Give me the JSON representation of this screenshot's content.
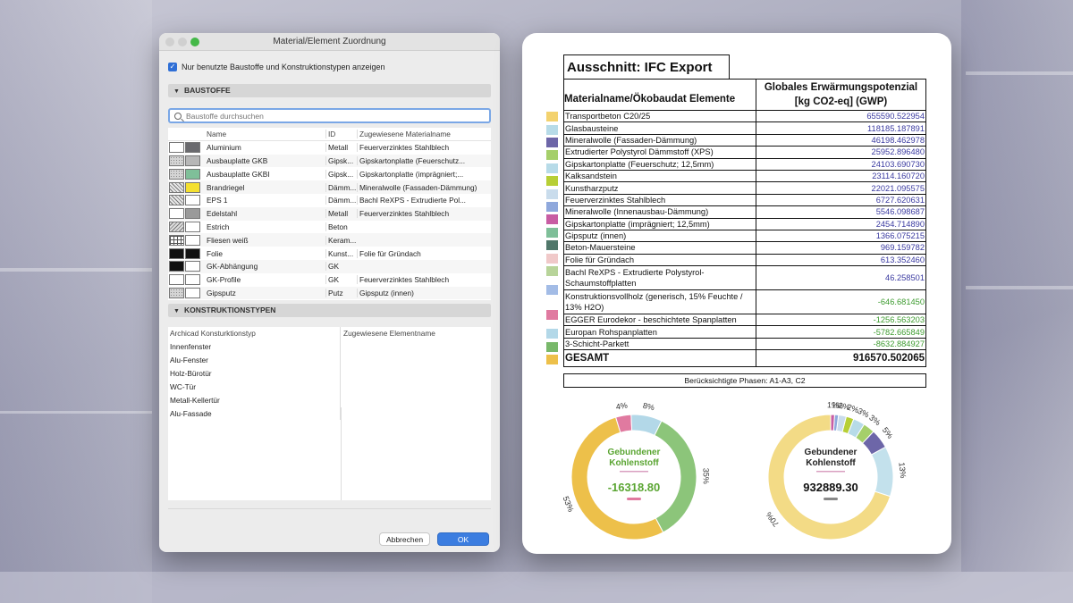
{
  "dialog": {
    "title": "Material/Element Zuordnung",
    "checkbox_label": "Nur benutzte Baustoffe und Konstruktionstypen anzeigen",
    "section_materials": "BAUSTOFFE",
    "search_placeholder": "Baustoffe durchsuchen",
    "materials_columns": {
      "name": "Name",
      "id": "ID",
      "assigned": "Zugewiesene Materialname"
    },
    "materials": [
      {
        "name": "Aluminium",
        "id": "Metall",
        "assigned": "Feuerverzinktes Stahlblech",
        "sw1": "#ffffff",
        "sw2": "#6a6a6e",
        "p1": "plain",
        "p2": "plain"
      },
      {
        "name": "Ausbauplatte GKB",
        "id": "Gipsk...",
        "assigned": "Gipskartonplatte (Feuerschutz...",
        "sw1": "#d4d4d4",
        "sw2": "#b7b7b7",
        "p1": "dots",
        "p2": "plain"
      },
      {
        "name": "Ausbauplatte GKBI",
        "id": "Gipsk...",
        "assigned": "Gipskartonplatte (imprägniert;...",
        "sw1": "#d4d4d4",
        "sw2": "#7fbf99",
        "p1": "dots",
        "p2": "plain"
      },
      {
        "name": "Brandriegel",
        "id": "Dämm...",
        "assigned": "Mineralwolle (Fassaden-Dämmung)",
        "sw1": "#e8e8e8",
        "sw2": "#f4e030",
        "p1": "wave",
        "p2": "plain"
      },
      {
        "name": "EPS 1",
        "id": "Dämm...",
        "assigned": "Bachl ReXPS - Extrudierte Pol...",
        "sw1": "#e8e8e8",
        "sw2": "#ffffff",
        "p1": "wave",
        "p2": "plain"
      },
      {
        "name": "Edelstahl",
        "id": "Metall",
        "assigned": "Feuerverzinktes Stahlblech",
        "sw1": "#ffffff",
        "sw2": "#9a9a9a",
        "p1": "plain",
        "p2": "plain"
      },
      {
        "name": "Estrich",
        "id": "Beton",
        "assigned": "",
        "sw1": "#dcdcdc",
        "sw2": "#ffffff",
        "p1": "hatch",
        "p2": "plain"
      },
      {
        "name": "Fliesen weiß",
        "id": "Keram...",
        "assigned": "",
        "sw1": "#ffffff",
        "sw2": "#ffffff",
        "p1": "grid",
        "p2": "plain"
      },
      {
        "name": "Folie",
        "id": "Kunst...",
        "assigned": "Folie für Gründach",
        "sw1": "#111111",
        "sw2": "#111111",
        "p1": "plain",
        "p2": "plain"
      },
      {
        "name": "GK-Abhängung",
        "id": "GK",
        "assigned": "",
        "sw1": "#111111",
        "sw2": "#ffffff",
        "p1": "plain",
        "p2": "plain"
      },
      {
        "name": "GK-Profile",
        "id": "GK",
        "assigned": "Feuerverzinktes Stahlblech",
        "sw1": "#ffffff",
        "sw2": "#ffffff",
        "p1": "plain",
        "p2": "plain"
      },
      {
        "name": "Gipsputz",
        "id": "Putz",
        "assigned": "Gipsputz (innen)",
        "sw1": "#d4d4d4",
        "sw2": "#ffffff",
        "p1": "dots",
        "p2": "plain"
      }
    ],
    "section_types": "KONSTRUKTIONSTYPEN",
    "types_columns": {
      "type": "Archicad Konsturktionstyp",
      "element": "Zugewiesene Elementname"
    },
    "types": [
      "Innenfenster",
      "Alu-Fenster",
      "Holz-Bürotür",
      "WC-Tür",
      "Metall-Kellertür",
      "Alu-Fassade"
    ],
    "cancel_label": "Abbrechen",
    "ok_label": "OK"
  },
  "report": {
    "title": "Ausschnitt: IFC Export",
    "col_name": "Materialname/Ökobaudat Elemente",
    "col_value_line1": "Globales Erwärmungspotenzial",
    "col_value_line2": "[kg CO2-eq] (GWP)",
    "rows": [
      {
        "name": "Transportbeton C20/25",
        "value": "655590.522954",
        "color": "#f3d26e",
        "val_color": "#3a3aa0",
        "lines": 1
      },
      {
        "name": "Glasbausteine",
        "value": "118185.187891",
        "color": "#b7dbe8",
        "val_color": "#3a3aa0",
        "lines": 1
      },
      {
        "name": "Mineralwolle (Fassaden-Dämmung)",
        "value": "46198.462978",
        "color": "#6d66a8",
        "val_color": "#3a3aa0",
        "lines": 1
      },
      {
        "name": "Extrudierter Polystyrol Dämmstoff (XPS)",
        "value": "25952.896480",
        "color": "#a5cf6a",
        "val_color": "#3a3aa0",
        "lines": 1
      },
      {
        "name": "Gipskartonplatte (Feuerschutz; 12,5mm)",
        "value": "24103.690730",
        "color": "#b7dbe8",
        "val_color": "#3a3aa0",
        "lines": 1
      },
      {
        "name": "Kalksandstein",
        "value": "23114.160720",
        "color": "#b7cf36",
        "val_color": "#3a3aa0",
        "lines": 1
      },
      {
        "name": "Kunstharzputz",
        "value": "22021.095575",
        "color": "#c9dcec",
        "val_color": "#3a3aa0",
        "lines": 1
      },
      {
        "name": "Feuerverzinktes Stahlblech",
        "value": "6727.620631",
        "color": "#8fa8dc",
        "val_color": "#3a3aa0",
        "lines": 1
      },
      {
        "name": "Mineralwolle (Innenausbau-Dämmung)",
        "value": "5546.098687",
        "color": "#c85da3",
        "val_color": "#3a3aa0",
        "lines": 1
      },
      {
        "name": "Gipskartonplatte (imprägniert; 12,5mm)",
        "value": "2454.714890",
        "color": "#7fbf99",
        "val_color": "#3a3aa0",
        "lines": 1
      },
      {
        "name": "Gipsputz (innen)",
        "value": "1366.075215",
        "color": "#50776a",
        "val_color": "#3a3aa0",
        "lines": 1
      },
      {
        "name": "Beton-Mauersteine",
        "value": "969.159782",
        "color": "#f0c9c9",
        "val_color": "#3a3aa0",
        "lines": 1
      },
      {
        "name": "Folie für Gründach",
        "value": "613.352460",
        "color": "#b8d49a",
        "val_color": "#3a3aa0",
        "lines": 1
      },
      {
        "name": "Bachl ReXPS - Extrudierte Polystyrol-Schaumstoffplatten",
        "value": "46.258501",
        "color": "#a3bce6",
        "val_color": "#3a3aa0",
        "lines": 2
      },
      {
        "name": "Konstruktionsvollholz (generisch, 15% Feuchte / 13% H2O)",
        "value": "-646.681450",
        "color": "#e07aa0",
        "val_color": "#3d9b2f",
        "lines": 2
      },
      {
        "name": "EGGER Eurodekor - beschichtete Spanplatten",
        "value": "-1256.563203",
        "color": "#b3d8e8",
        "val_color": "#3d9b2f",
        "lines": 1
      },
      {
        "name": "Europan Rohspanplatten",
        "value": "-5782.665849",
        "color": "#78b86a",
        "val_color": "#3d9b2f",
        "lines": 1
      },
      {
        "name": "3-Schicht-Parkett",
        "value": "-8632.884927",
        "color": "#edc04a",
        "val_color": "#3d9b2f",
        "lines": 1
      }
    ],
    "total_label": "GESAMT",
    "total_value": "916570.502065",
    "phases": "Berücksichtigte Phasen: A1-A3, C2"
  },
  "chart_data": [
    {
      "type": "pie",
      "title": "Gebundener Kohlenstoff",
      "center_value": "-16318.80",
      "title_color": "#5aa532",
      "categories": [
        "Konstruktionsvollholz (generisch, 15% Feuchte / 13% H2O)",
        "EGGER Eurodekor - beschichtete Spanplatten",
        "Europan Rohspanplatten",
        "3-Schicht-Parkett"
      ],
      "values": [
        4,
        8,
        35,
        53
      ],
      "labels": [
        "4%",
        "8%",
        "35%",
        "53%"
      ],
      "colors": [
        "#e07aa0",
        "#b3d8e8",
        "#8cc57a",
        "#edc04a"
      ]
    },
    {
      "type": "pie",
      "title": "Gebundener Kohlenstoff",
      "center_value": "932889.30",
      "title_color": "#222222",
      "categories": [
        "Transportbeton C20/25",
        "Glasbausteine",
        "Mineralwolle (Fassaden-Dämmung)",
        "Extrudierter Polystyrol Dämmstoff (XPS)",
        "Gipskartonplatte (Feuerschutz; 12,5mm)",
        "Kalksandstein",
        "Kunstharzputz",
        "Feuerverzinktes Stahlblech",
        "Mineralwolle (Innenausbau-Dämmung)"
      ],
      "values": [
        70,
        13,
        5,
        3,
        3,
        2,
        2,
        1,
        1
      ],
      "labels": [
        "70%",
        "13%",
        "5%",
        "3%",
        "3%",
        "2%",
        "2%",
        "1%",
        "1%"
      ],
      "colors": [
        "#f3db86",
        "#c3e1ec",
        "#6d66a8",
        "#a5cf6a",
        "#b7dbe8",
        "#b7cf36",
        "#c9dcec",
        "#8fa8dc",
        "#c85da3"
      ]
    }
  ]
}
